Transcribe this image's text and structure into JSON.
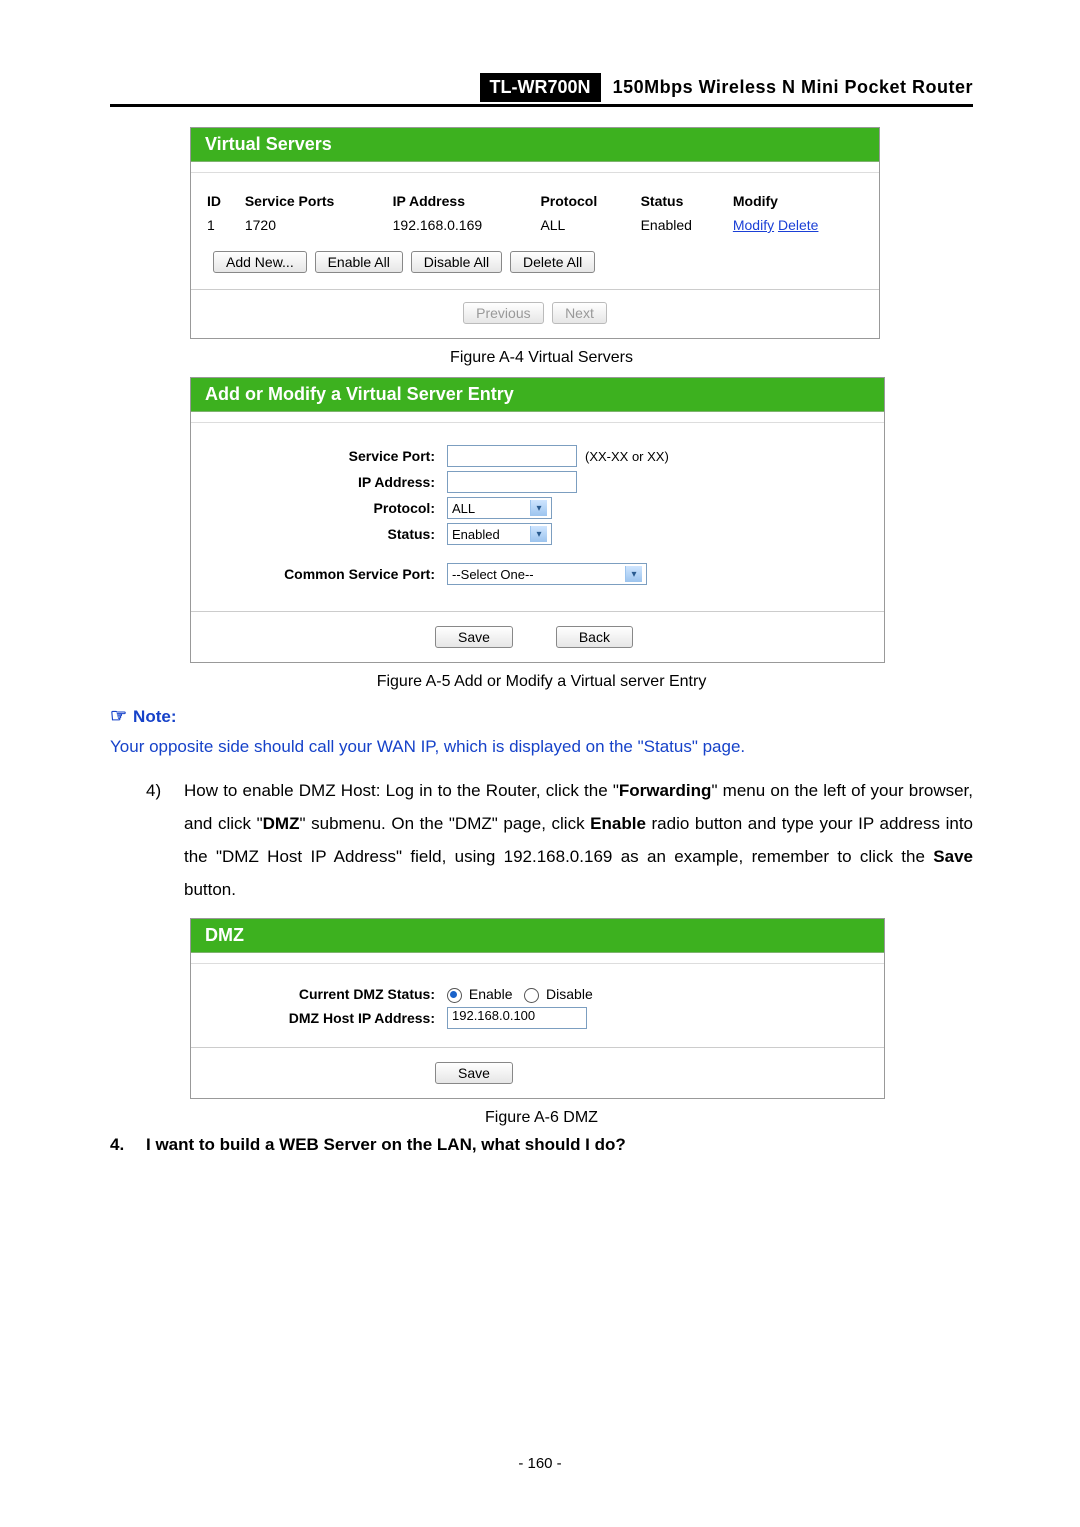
{
  "header": {
    "model": "TL-WR700N",
    "description": "150Mbps  Wireless  N  Mini  Pocket  Router"
  },
  "fig4": {
    "title": "Virtual Servers",
    "columns": [
      "ID",
      "Service Ports",
      "IP Address",
      "Protocol",
      "Status",
      "Modify"
    ],
    "row": {
      "id": "1",
      "port": "1720",
      "ip": "192.168.0.169",
      "proto": "ALL",
      "status": "Enabled",
      "modify": "Modify",
      "delete": "Delete"
    },
    "buttons": {
      "add": "Add New...",
      "enable": "Enable All",
      "disable": "Disable All",
      "delete": "Delete All",
      "prev": "Previous",
      "next": "Next"
    },
    "caption": "Figure A-4    Virtual Servers"
  },
  "fig5": {
    "title": "Add or Modify a Virtual Server Entry",
    "labels": {
      "serviceport": "Service Port:",
      "ip": "IP Address:",
      "protocol": "Protocol:",
      "status": "Status:",
      "common": "Common Service Port:"
    },
    "values": {
      "protocol": "ALL",
      "status": "Enabled",
      "common": "--Select One--",
      "hint": "(XX-XX or XX)"
    },
    "buttons": {
      "save": "Save",
      "back": "Back"
    },
    "caption": "Figure A-5    Add or Modify a Virtual server Entry"
  },
  "note": {
    "label": "Note:",
    "text": "Your opposite side should call your WAN IP, which is displayed on the \"Status\" page."
  },
  "step4": {
    "num": "4)",
    "parts": [
      "How to enable DMZ Host: Log in to the Router, click the \"",
      "Forwarding",
      "\" menu on the left of your browser, and click \"",
      "DMZ",
      "\" submenu. On the \"DMZ\" page, click ",
      "Enable",
      " radio button and type your IP address into the \"DMZ Host IP Address\" field, using 192.168.0.169 as an example, remember to click the ",
      "Save",
      " button."
    ]
  },
  "fig6": {
    "title": "DMZ",
    "labels": {
      "status": "Current DMZ Status:",
      "ip": "DMZ Host IP Address:"
    },
    "values": {
      "enable": "Enable",
      "disable": "Disable",
      "ip": "192.168.0.100"
    },
    "buttons": {
      "save": "Save"
    },
    "caption": "Figure A-6    DMZ"
  },
  "q4": {
    "num": "4.",
    "text": "I want to build a WEB Server on the LAN, what should I do?"
  },
  "pageNumber": "- 160 -"
}
